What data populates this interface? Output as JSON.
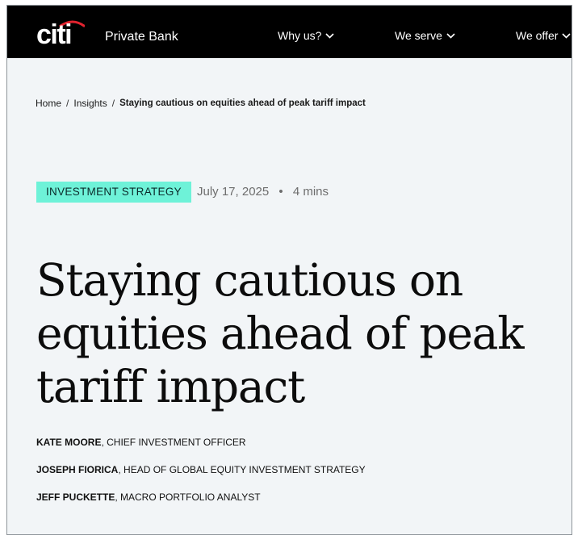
{
  "header": {
    "logo_text": "citi",
    "brand_sub": "Private Bank",
    "nav": [
      {
        "label": "Why us?"
      },
      {
        "label": "We serve"
      },
      {
        "label": "We offer"
      }
    ]
  },
  "breadcrumb": {
    "items": [
      "Home",
      "Insights"
    ],
    "current": "Staying cautious on equities ahead of peak tariff impact"
  },
  "article": {
    "category": "INVESTMENT STRATEGY",
    "date": "July 17, 2025",
    "separator": "•",
    "read_time": "4 mins",
    "title": "Staying cautious on equities ahead of peak tariff impact",
    "authors": [
      {
        "name": "KATE MOORE",
        "role": ", CHIEF INVESTMENT OFFICER"
      },
      {
        "name": "JOSEPH FIORICA",
        "role": ", HEAD OF GLOBAL EQUITY INVESTMENT STRATEGY"
      },
      {
        "name": "JEFF PUCKETTE",
        "role": ", MACRO PORTFOLIO ANALYST"
      }
    ]
  },
  "colors": {
    "header_bg": "#000000",
    "page_bg": "#f2f5f7",
    "tag_bg": "#6ef2d8",
    "logo_arc": "#e3232f"
  },
  "icons": [
    "citi-logo",
    "chevron-down-icon"
  ]
}
